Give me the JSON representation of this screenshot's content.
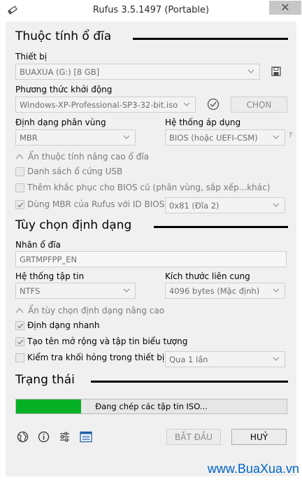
{
  "window": {
    "title": "Rufus 3.5.1497 (Portable)",
    "close": "✕"
  },
  "drive_properties": {
    "title": "Thuộc tính ổ đĩa",
    "device_label": "Thiết bị",
    "device_value": "BUAXUA (G:) [8 GB]",
    "boot_label": "Phương thức khởi động",
    "boot_value": "Windows-XP-Professional-SP3-32-bit.iso",
    "select_button": "CHỌN",
    "partition_label": "Định dạng phân vùng",
    "partition_value": "MBR",
    "target_label": "Hệ thống áp dụng",
    "target_value": "BIOS (hoặc UEFI-CSM)",
    "help_mark": "?",
    "advanced_toggle": "Ẩn thuộc tính nâng cao ổ đĩa",
    "list_usb": "Danh sách ổ cứng USB",
    "old_bios_fixes": "Thêm khắc phục cho BIOS cũ (phân vùng, sắp xếp...khác)",
    "use_rufus_mbr": "Dùng MBR của Rufus với ID BIOS",
    "bios_id_value": "0x81 (Đĩa 2)"
  },
  "format_options": {
    "title": "Tùy chọn định dạng",
    "volume_label": "Nhãn ổ đĩa",
    "volume_value": "GRTMPFPP_EN",
    "fs_label": "Hệ thống tập tin",
    "fs_value": "NTFS",
    "cluster_label": "Kích thước liên cung",
    "cluster_value": "4096 bytes (Mặc định)",
    "advanced_toggle": "Ẩn tùy chọn định dạng nâng cao",
    "quick_format": "Định dạng nhanh",
    "extended_label": "Tạo tên mở rộng và tập tin biểu tượng",
    "bad_blocks": "Kiểm tra khối hỏng trong thiết bị",
    "passes_value": "Qua 1 lần"
  },
  "status": {
    "title": "Trạng thái",
    "progress_text": "Đang chép các tập tin ISO...",
    "progress_fraction": 0.24,
    "progress_color": "#06b025"
  },
  "footer": {
    "start_button": "BẮT ĐẦU",
    "cancel_button": "HUỶ",
    "icons": [
      "globe-icon",
      "info-icon",
      "settings-sliders-icon",
      "log-icon"
    ]
  },
  "watermark": "www.BuaXua.vn",
  "colors": {
    "accent": "#06b025",
    "watermark": "#0064c8",
    "section_rule": "#000000"
  }
}
